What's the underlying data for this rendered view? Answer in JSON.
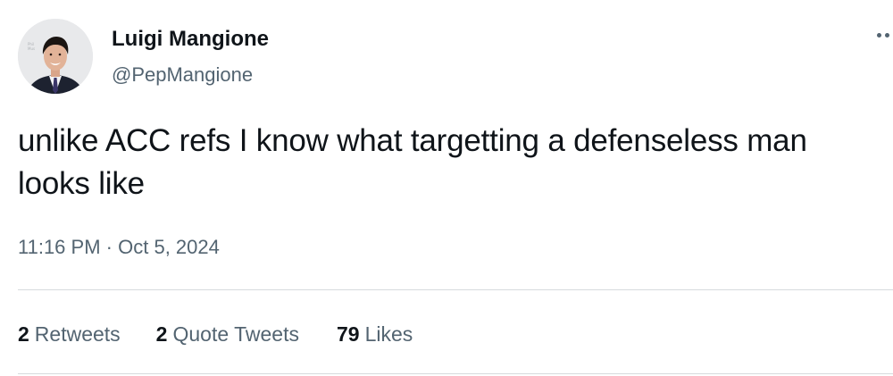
{
  "author": {
    "name": "Luigi Mangione",
    "handle": "@PepMangione",
    "avatar_icon": "profile-photo"
  },
  "tweet": {
    "text": "unlike ACC refs I know what targetting a defenseless man looks like",
    "time": "11:16 PM",
    "separator": "·",
    "date": "Oct 5, 2024"
  },
  "menu": {
    "icon": "more-horizontal-icon"
  },
  "stats": {
    "retweets": {
      "count": "2",
      "label": "Retweets"
    },
    "quotes": {
      "count": "2",
      "label": "Quote Tweets"
    },
    "likes": {
      "count": "79",
      "label": "Likes"
    }
  },
  "colors": {
    "primary_text": "#0f1419",
    "secondary_text": "#536471",
    "divider": "#d6dadd",
    "background": "#ffffff"
  }
}
